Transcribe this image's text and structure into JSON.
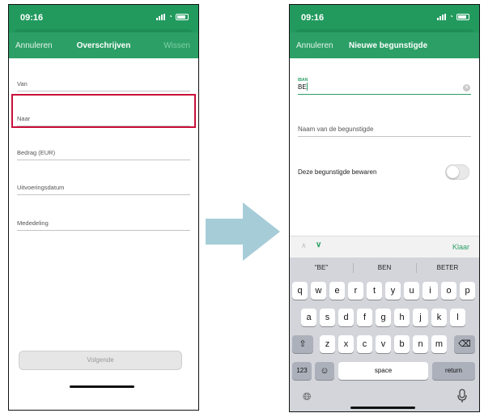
{
  "left_screen": {
    "time": "09:16",
    "nav": {
      "cancel": "Annuleren",
      "title": "Overschrijven",
      "clear": "Wissen"
    },
    "fields": [
      {
        "label": "Van"
      },
      {
        "label": "Naar"
      },
      {
        "label": "Bedrag (EUR)"
      },
      {
        "label": "Uitvoeringsdatum"
      },
      {
        "label": "Mededeling"
      }
    ],
    "next_button": "Volgende"
  },
  "right_screen": {
    "time": "09:16",
    "nav": {
      "cancel": "Annuleren",
      "title": "Nieuwe begunstigde"
    },
    "iban": {
      "label": "IBAN",
      "value": "BE"
    },
    "name_field": {
      "label": "Naam van de begunstigde"
    },
    "save": {
      "label": "Deze begunstigde bewaren",
      "enabled": false
    },
    "done": "Klaar",
    "suggestions": [
      "\"BE\"",
      "BEN",
      "BETER"
    ],
    "keyboard": {
      "row1": [
        "q",
        "w",
        "e",
        "r",
        "t",
        "y",
        "u",
        "i",
        "o",
        "p"
      ],
      "row2": [
        "a",
        "s",
        "d",
        "f",
        "g",
        "h",
        "j",
        "k",
        "l"
      ],
      "row3": [
        "z",
        "x",
        "c",
        "v",
        "b",
        "n",
        "m"
      ],
      "numbers": "123",
      "space": "space",
      "return": "return"
    }
  },
  "colors": {
    "brand_green": "#2c9f66",
    "highlight_red": "#c8103a",
    "arrow_blue": "#a6ccd8"
  }
}
